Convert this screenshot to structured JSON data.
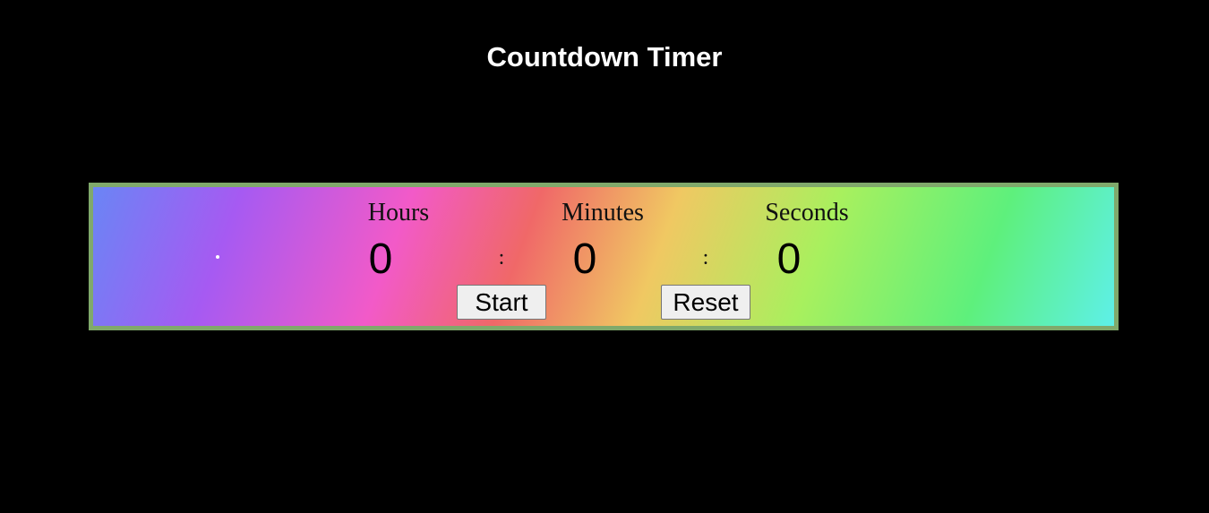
{
  "page": {
    "title": "Countdown Timer"
  },
  "timer": {
    "hours": {
      "label": "Hours",
      "value": "0"
    },
    "minutes": {
      "label": "Minutes",
      "value": "0"
    },
    "seconds": {
      "label": "Seconds",
      "value": "0"
    },
    "separator": ":"
  },
  "controls": {
    "start_label": "Start",
    "reset_label": "Reset"
  },
  "colors": {
    "background": "#000000",
    "title": "#ffffff",
    "panel_border": "#80a96b",
    "gradient_stops": [
      "#6a85f5",
      "#a65af2",
      "#f25ac8",
      "#f06868",
      "#f0c862",
      "#a8f05e",
      "#5ef07c",
      "#5ef0e8"
    ]
  }
}
